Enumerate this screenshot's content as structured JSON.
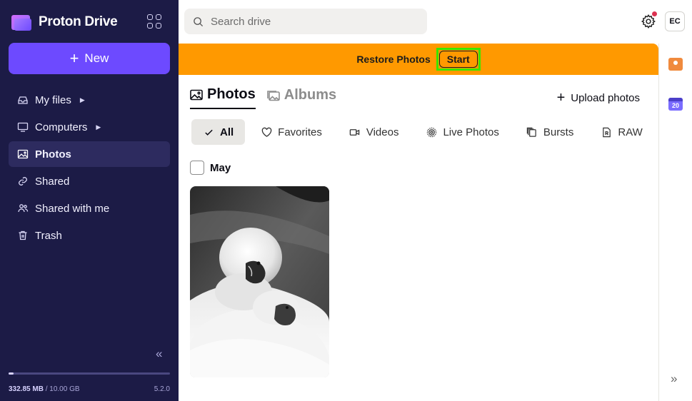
{
  "app": {
    "logo_text": "Proton Drive",
    "new_label": "New",
    "version": "5.2.0"
  },
  "sidebar": {
    "items": [
      {
        "label": "My files",
        "icon": "inbox-icon",
        "has_caret": true,
        "active": false
      },
      {
        "label": "Computers",
        "icon": "monitor-icon",
        "has_caret": true,
        "active": false
      },
      {
        "label": "Photos",
        "icon": "image-icon",
        "has_caret": false,
        "active": true
      },
      {
        "label": "Shared",
        "icon": "link-icon",
        "has_caret": false,
        "active": false
      },
      {
        "label": "Shared with me",
        "icon": "users-icon",
        "has_caret": false,
        "active": false
      },
      {
        "label": "Trash",
        "icon": "trash-icon",
        "has_caret": false,
        "active": false
      }
    ],
    "storage": {
      "used": "332.85 MB",
      "separator": " / ",
      "total": "10.00 GB",
      "fraction_used": 0.033
    }
  },
  "header": {
    "search_placeholder": "Search drive",
    "avatar_initials": "EC",
    "settings_has_notification": true
  },
  "banner": {
    "text": "Restore Photos",
    "button_label": "Start",
    "color": "#ff9900"
  },
  "main": {
    "tabs": [
      {
        "label": "Photos",
        "active": true
      },
      {
        "label": "Albums",
        "active": false
      }
    ],
    "upload_label": "Upload photos",
    "filters": [
      {
        "label": "All",
        "icon": "check-icon",
        "active": true
      },
      {
        "label": "Favorites",
        "icon": "heart-icon",
        "active": false
      },
      {
        "label": "Videos",
        "icon": "video-icon",
        "active": false
      },
      {
        "label": "Live Photos",
        "icon": "live-photo-icon",
        "active": false
      },
      {
        "label": "Bursts",
        "icon": "bursts-icon",
        "active": false
      },
      {
        "label": "RAW",
        "icon": "raw-icon",
        "active": false
      }
    ],
    "section_label": "May"
  },
  "rail": {
    "calendar_day": "20"
  },
  "colors": {
    "sidebar_bg": "#1c1b46",
    "accent": "#6d4aff",
    "banner": "#ff9900",
    "highlight": "#39e600"
  }
}
